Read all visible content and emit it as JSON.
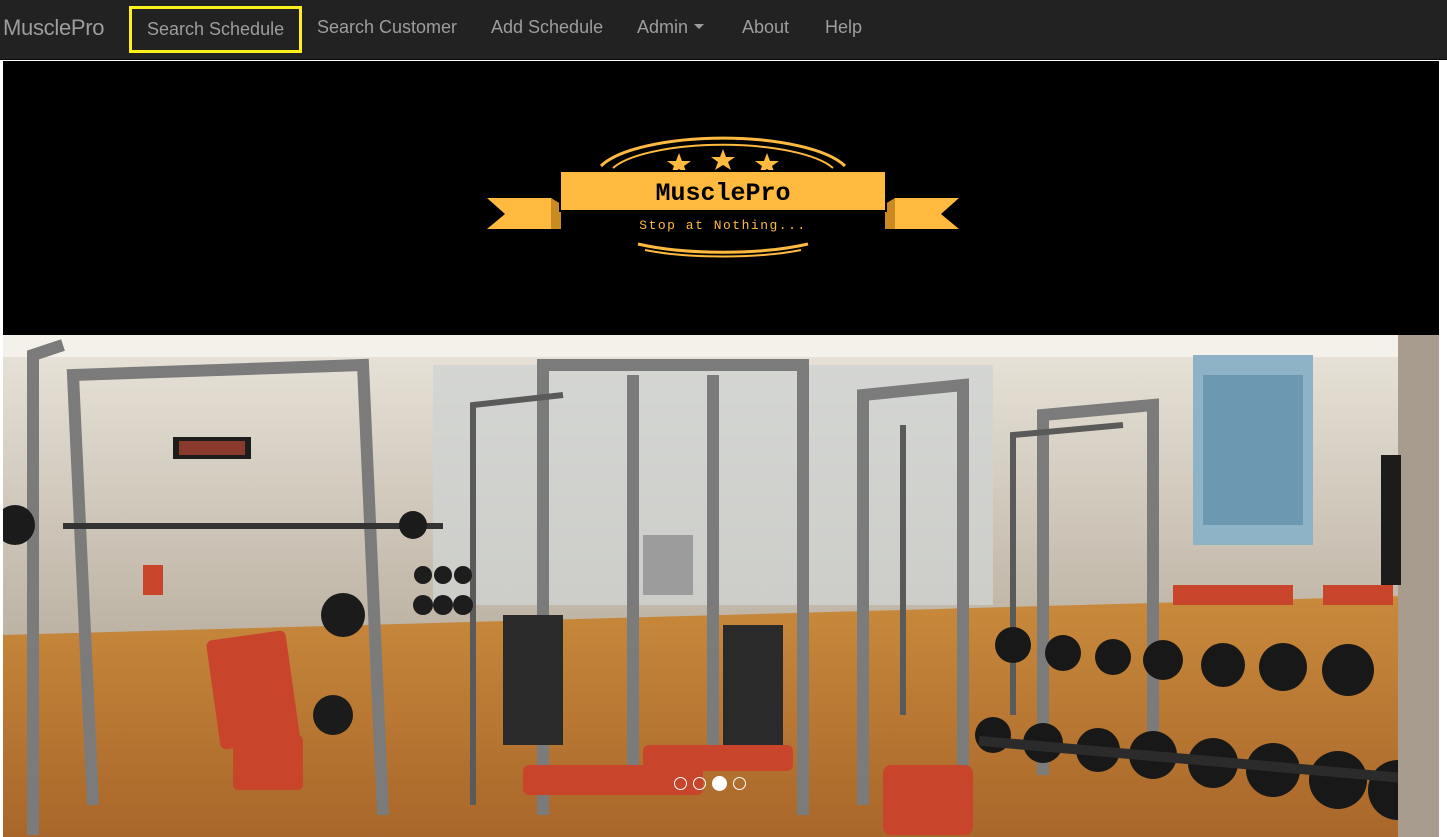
{
  "navbar": {
    "brand": "MusclePro",
    "items": [
      {
        "label": "Search Schedule",
        "highlighted": true
      },
      {
        "label": "Search Customer"
      },
      {
        "label": "Add Schedule"
      },
      {
        "label": "Admin",
        "dropdown": true
      },
      {
        "label": "About"
      },
      {
        "label": "Help"
      }
    ]
  },
  "banner": {
    "logo_title": "MusclePro",
    "logo_tagline": "Stop at Nothing...",
    "accent_color": "#ffba3f"
  },
  "carousel": {
    "image": "gym-interior-photo",
    "slide_count": 4,
    "active_slide": 3
  },
  "colors": {
    "navbar_bg": "#222222",
    "nav_text": "#9d9d9d",
    "highlight_border": "#ffef1a"
  }
}
